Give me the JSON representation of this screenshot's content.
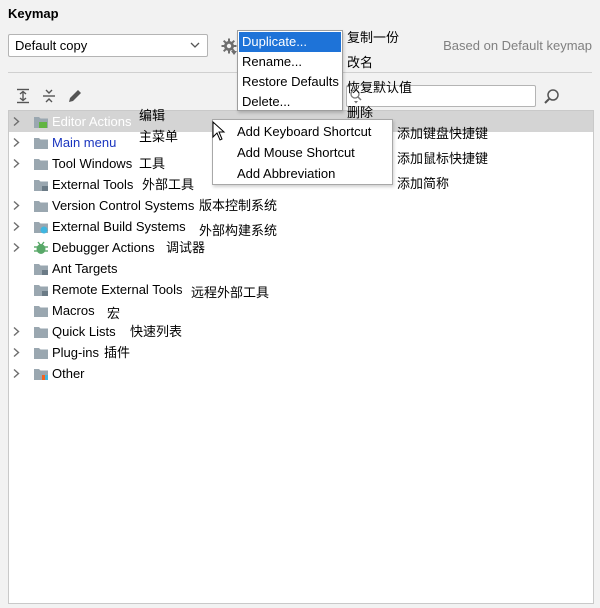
{
  "panel": {
    "title": "Keymap"
  },
  "keymap_select": {
    "value": "Default copy"
  },
  "based_on_text": "Based on Default keymap",
  "search": {
    "placeholder": ""
  },
  "dropdown_menu": {
    "items": [
      {
        "label": "Duplicate...",
        "note": "复制一份",
        "highlighted": true
      },
      {
        "label": "Rename...",
        "note": "改名"
      },
      {
        "label": "Restore Defaults",
        "note": "恢复默认值"
      },
      {
        "label": "Delete...",
        "note": "删除"
      }
    ]
  },
  "context_menu": {
    "items": [
      {
        "label": "Add Keyboard Shortcut",
        "note": "添加键盘快捷键"
      },
      {
        "label": "Add Mouse Shortcut",
        "note": "添加鼠标快捷键"
      },
      {
        "label": "Add Abbreviation",
        "note": "添加简称"
      }
    ]
  },
  "tree": {
    "rows": [
      {
        "label": "Editor Actions",
        "note": "编辑",
        "expandable": true,
        "selected": true,
        "icon": "editor-actions-icon"
      },
      {
        "label": "Main menu",
        "note": "主菜单",
        "expandable": true,
        "link": true,
        "icon": "folder-icon"
      },
      {
        "label": "Tool Windows",
        "note": "工具",
        "expandable": true,
        "icon": "folder-icon"
      },
      {
        "label": "External Tools",
        "note": "外部工具",
        "expandable": false,
        "icon": "external-tools-icon"
      },
      {
        "label": "Version Control Systems",
        "note": "版本控制系统",
        "expandable": true,
        "icon": "folder-icon"
      },
      {
        "label": "External Build Systems",
        "note": "外部构建系统",
        "expandable": true,
        "icon": "build-systems-icon"
      },
      {
        "label": "Debugger Actions",
        "note": "调试器",
        "expandable": true,
        "icon": "bug-icon"
      },
      {
        "label": "Ant Targets",
        "note": "",
        "expandable": false,
        "icon": "ant-targets-icon"
      },
      {
        "label": "Remote External Tools",
        "note": "远程外部工具",
        "expandable": false,
        "icon": "remote-tools-icon"
      },
      {
        "label": "Macros",
        "note": "宏",
        "expandable": false,
        "icon": "folder-icon"
      },
      {
        "label": "Quick Lists",
        "note": "快速列表",
        "expandable": true,
        "icon": "folder-icon"
      },
      {
        "label": "Plug-ins",
        "note": "插件",
        "expandable": true,
        "icon": "folder-icon"
      },
      {
        "label": "Other",
        "note": "",
        "expandable": true,
        "icon": "other-icon"
      }
    ]
  },
  "colors": {
    "selection_bg": "#d4d4d4",
    "menu_highlight": "#1e73d8",
    "link_text": "#1a35bf",
    "debug_green": "#59a869"
  }
}
